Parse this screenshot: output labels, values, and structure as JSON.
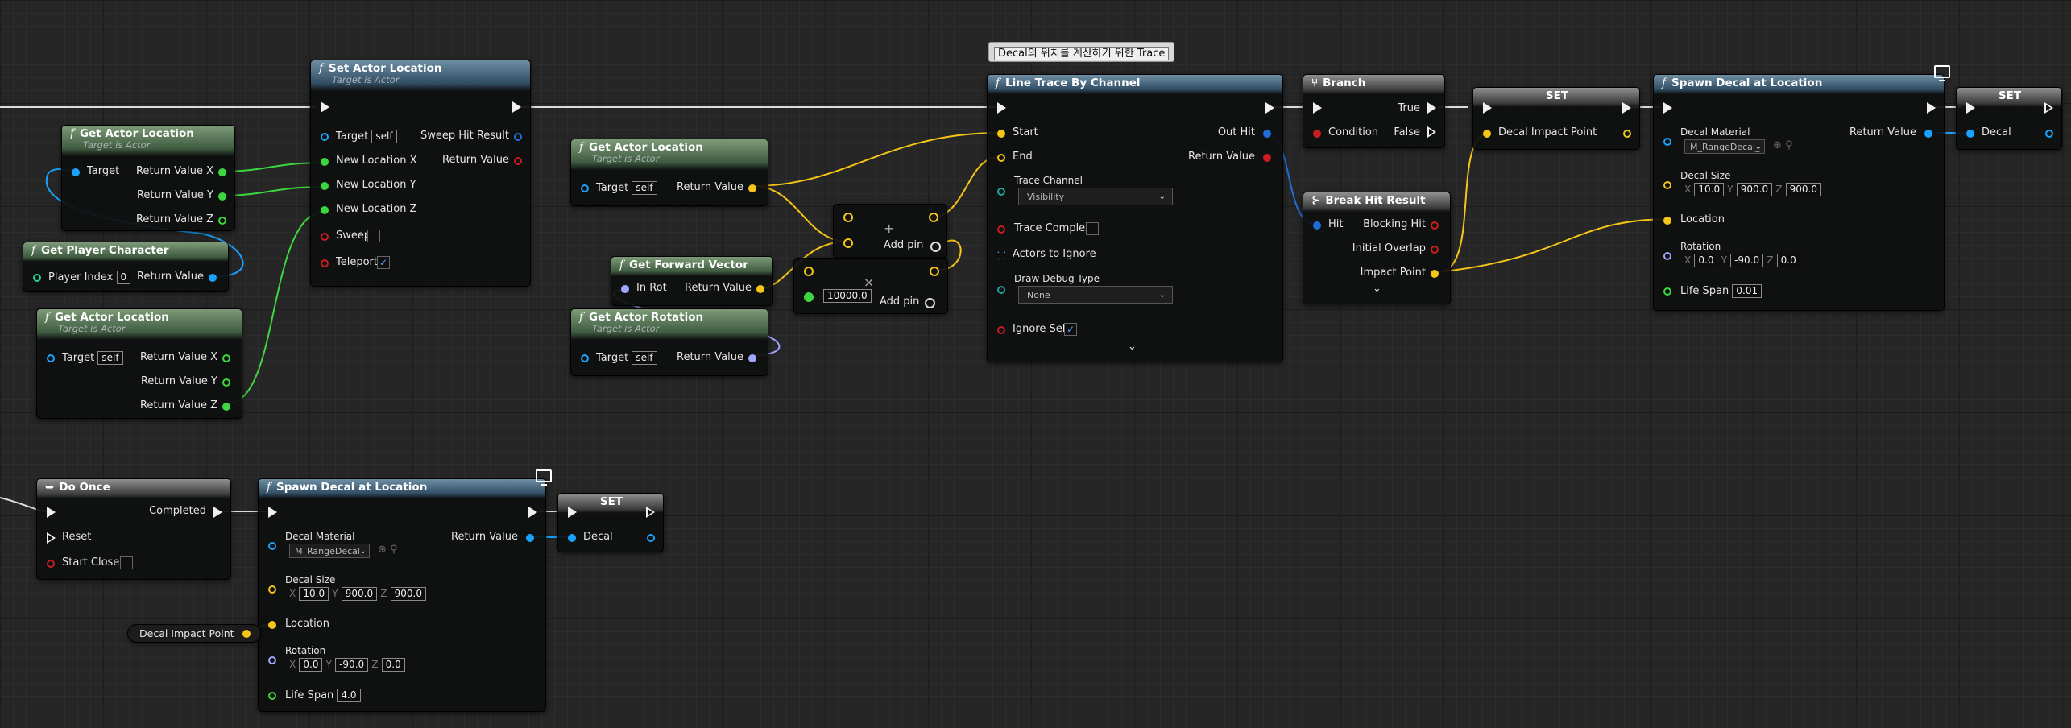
{
  "comment": {
    "text": "Decal의 위치를 계산하기 위한 Trace"
  },
  "set_actor_location": {
    "title": "Set Actor Location",
    "subtitle": "Target is Actor",
    "target": "Target",
    "target_value": "self",
    "new_x": "New Location X",
    "new_y": "New Location Y",
    "new_z": "New Location Z",
    "sweep": "Sweep",
    "teleport": "Teleport",
    "teleport_check": "✓",
    "sweep_hit": "Sweep Hit Result",
    "return_value": "Return Value"
  },
  "get_actor_location_1": {
    "title": "Get Actor Location",
    "subtitle": "Target is Actor",
    "target": "Target",
    "rx": "Return Value X",
    "ry": "Return Value Y",
    "rz": "Return Value Z"
  },
  "get_player_character": {
    "title": "Get Player Character",
    "player_index": "Player Index",
    "index_value": "0",
    "return_value": "Return Value"
  },
  "get_actor_location_2": {
    "title": "Get Actor Location",
    "subtitle": "Target is Actor",
    "target": "Target",
    "target_value": "self",
    "rx": "Return Value X",
    "ry": "Return Value Y",
    "rz": "Return Value Z"
  },
  "get_actor_location_3": {
    "title": "Get Actor Location",
    "subtitle": "Target is Actor",
    "target": "Target",
    "target_value": "self",
    "return_value": "Return Value"
  },
  "add_node_1": {
    "add_pin": "Add pin",
    "plus": "+"
  },
  "get_forward_vector": {
    "title": "Get Forward Vector",
    "in_rot": "In Rot",
    "return_value": "Return Value"
  },
  "multiply_node": {
    "value": "10000.0",
    "add_pin": "Add pin",
    "x": "×"
  },
  "get_actor_rotation": {
    "title": "Get Actor Rotation",
    "subtitle": "Target is Actor",
    "target": "Target",
    "target_value": "self",
    "return_value": "Return Value"
  },
  "line_trace": {
    "title": "Line Trace By Channel",
    "start": "Start",
    "end": "End",
    "out_hit": "Out Hit",
    "return_value": "Return Value",
    "trace_channel": "Trace Channel",
    "trace_channel_value": "Visibility",
    "trace_complex": "Trace Complex",
    "actors_to_ignore": "Actors to Ignore",
    "draw_debug_type": "Draw Debug Type",
    "draw_debug_value": "None",
    "ignore_self": "Ignore Self",
    "ignore_self_check": "✓",
    "expand": "⌄"
  },
  "branch": {
    "title": "Branch",
    "condition": "Condition",
    "true_label": "True",
    "false_label": "False"
  },
  "break_hit": {
    "title": "Break Hit Result",
    "hit": "Hit",
    "blocking_hit": "Blocking Hit",
    "initial_overlap": "Initial Overlap",
    "impact_point": "Impact Point",
    "expand": "⌄"
  },
  "set_1": {
    "title": "SET",
    "decal_impact_point": "Decal Impact Point"
  },
  "spawn_decal_1": {
    "title": "Spawn Decal at Location",
    "decal_material": "Decal Material",
    "material_value": "M_RangeDecal_",
    "return_value": "Return Value",
    "decal_size": "Decal Size",
    "size_x": "10.0",
    "size_y": "900.0",
    "size_z": "900.0",
    "location": "Location",
    "rotation": "Rotation",
    "rot_x": "0.0",
    "rot_y": "-90.0",
    "rot_z": "0.0",
    "life_span": "Life Span",
    "life_span_value": "0.01",
    "lx": "X",
    "ly": "Y",
    "lz": "Z"
  },
  "set_2": {
    "title": "SET",
    "decal": "Decal"
  },
  "do_once": {
    "title": "Do Once",
    "completed": "Completed",
    "reset": "Reset",
    "start_closed": "Start Closed"
  },
  "spawn_decal_2": {
    "title": "Spawn Decal at Location",
    "decal_material": "Decal Material",
    "material_value": "M_RangeDecal_",
    "return_value": "Return Value",
    "decal_size": "Decal Size",
    "size_x": "10.0",
    "size_y": "900.0",
    "size_z": "900.0",
    "location": "Location",
    "rotation": "Rotation",
    "rot_x": "0.0",
    "rot_y": "-90.0",
    "rot_z": "0.0",
    "life_span": "Life Span",
    "life_span_value": "4.0",
    "lx": "X",
    "ly": "Y",
    "lz": "Z"
  },
  "set_3": {
    "title": "SET",
    "decal": "Decal"
  },
  "decal_impact_point_getter": {
    "label": "Decal Impact Point"
  },
  "colors": {
    "exec": "#f0f0f0",
    "vector": "#f5c518",
    "float": "#3ed63e",
    "object": "#19a3ff",
    "bool": "#c81e1e",
    "struct": "#1f6ed8",
    "rotator": "#9ea6ff",
    "int": "#1fd6a0"
  }
}
